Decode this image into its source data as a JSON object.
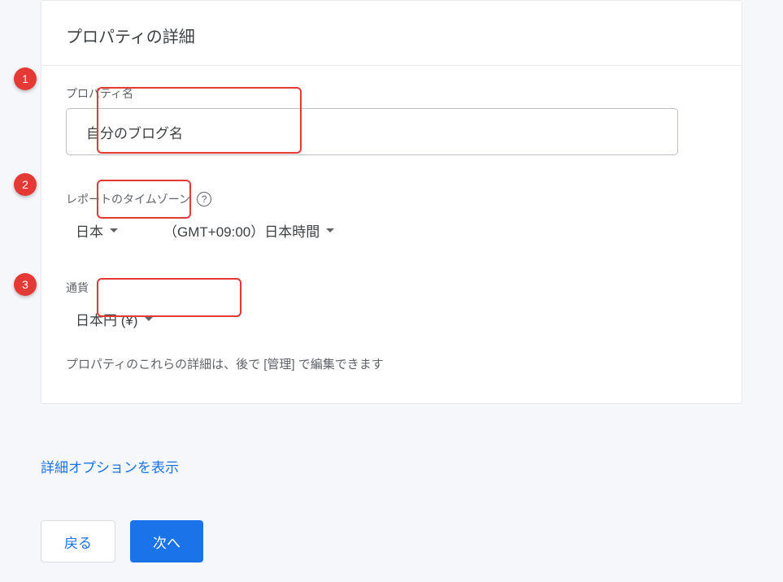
{
  "card": {
    "title": "プロパティの詳細"
  },
  "property_name": {
    "label": "プロパティ名",
    "value": "自分のブログ名"
  },
  "timezone": {
    "label": "レポートのタイムゾーン",
    "country": "日本",
    "offset": "（GMT+09:00）日本時間"
  },
  "currency": {
    "label": "通貨",
    "value": "日本円 (¥)"
  },
  "hint": "プロパティのこれらの詳細は、後で [管理] で編集できます",
  "options_link": "詳細オプションを表示",
  "buttons": {
    "back": "戻る",
    "next": "次へ"
  },
  "annotations": {
    "one": "1",
    "two": "2",
    "three": "3"
  }
}
